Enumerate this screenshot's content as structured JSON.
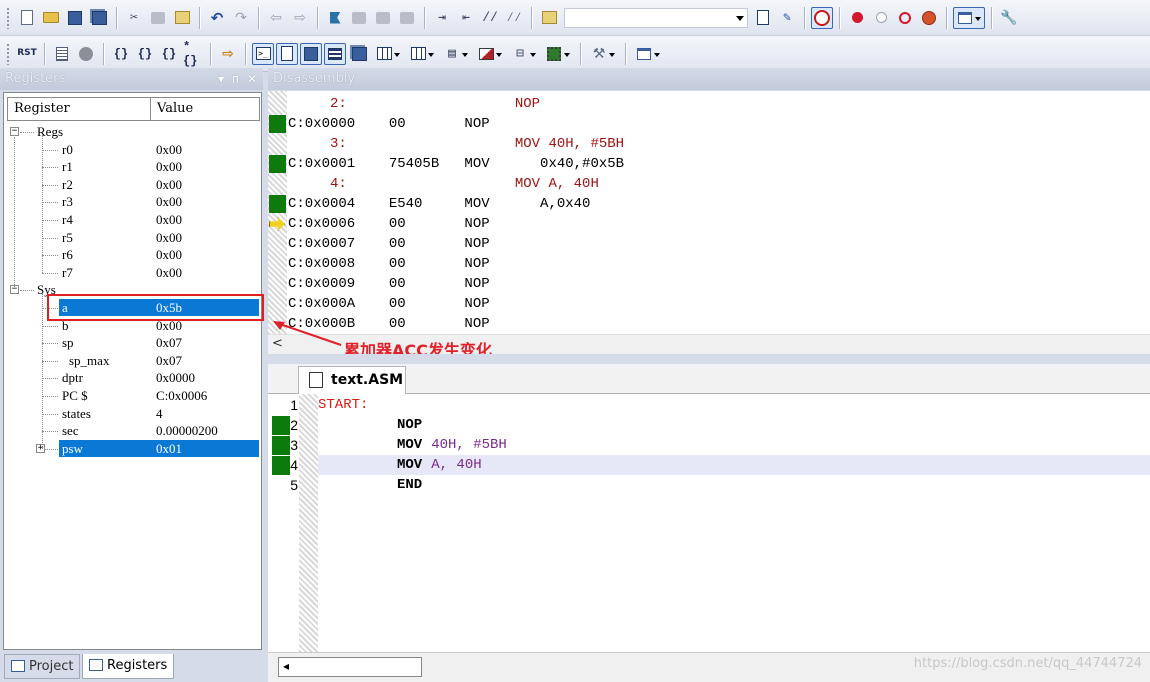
{
  "toolbar1": {
    "icons": [
      "new-file-icon",
      "open-folder-icon",
      "save-icon",
      "save-all-icon",
      "cut-icon",
      "copy-icon",
      "paste-icon",
      "undo-icon",
      "redo-icon",
      "nav-back-icon",
      "nav-forward-icon",
      "bookmark-icon",
      "bookmark-prev-icon",
      "bookmark-next-icon",
      "bookmark-clear-icon",
      "indent-icon",
      "unindent-icon",
      "comment-icon",
      "uncomment-icon",
      "find-in-files-icon",
      "target-combo",
      "find-icon",
      "insert-icon",
      "debug-session-icon",
      "breakpoint-insert-icon",
      "breakpoint-enable-icon",
      "breakpoint-disable-icon",
      "breakpoint-kill-icon",
      "window-layout-icon",
      "configure-icon"
    ],
    "target_combo_value": ""
  },
  "toolbar2": {
    "rst_label": "RST",
    "icons": [
      "reset-icon",
      "run-icon",
      "stop-icon",
      "step-into-icon",
      "step-over-icon",
      "step-out-icon",
      "run-to-cursor-icon",
      "show-next-statement-icon",
      "command-window-icon",
      "disassembly-window-icon",
      "symbols-window-icon",
      "registers-window-icon",
      "call-stack-icon",
      "watch-window-icon",
      "memory-window-icon",
      "serial-window-icon",
      "analysis-window-icon",
      "trace-window-icon",
      "system-viewer-icon",
      "toolbox-icon",
      "debug-restore-icon"
    ]
  },
  "registers": {
    "title": "Registers",
    "caption_buttons": [
      "▾",
      "ᴨ",
      "✕"
    ],
    "col_register": "Register",
    "col_value": "Value",
    "groups": [
      {
        "name": "Regs",
        "expander": "−",
        "rows": [
          {
            "name": "r0",
            "value": "0x00"
          },
          {
            "name": "r1",
            "value": "0x00"
          },
          {
            "name": "r2",
            "value": "0x00"
          },
          {
            "name": "r3",
            "value": "0x00"
          },
          {
            "name": "r4",
            "value": "0x00"
          },
          {
            "name": "r5",
            "value": "0x00"
          },
          {
            "name": "r6",
            "value": "0x00"
          },
          {
            "name": "r7",
            "value": "0x00"
          }
        ]
      },
      {
        "name": "Sys",
        "expander": "−",
        "rows": [
          {
            "name": "a",
            "value": "0x5b"
          },
          {
            "name": "b",
            "value": "0x00"
          },
          {
            "name": "sp",
            "value": "0x07"
          },
          {
            "name": "sp_max",
            "value": "0x07"
          },
          {
            "name": "dptr",
            "value": "0x0000"
          },
          {
            "name": "PC  $",
            "value": "C:0x0006"
          },
          {
            "name": "states",
            "value": "4"
          },
          {
            "name": "sec",
            "value": "0.00000200"
          },
          {
            "name": "psw",
            "value": "0x01",
            "expander": "+"
          }
        ]
      }
    ],
    "tabs": [
      {
        "label": "Project"
      },
      {
        "label": "Registers"
      }
    ]
  },
  "disassembly": {
    "title": "Disassembly",
    "rows": [
      {
        "kind": "src",
        "text": "     2:                    NOP"
      },
      {
        "kind": "asm",
        "text": "C:0x0000    00       NOP"
      },
      {
        "kind": "src",
        "text": "     3:                    MOV 40H, #5BH"
      },
      {
        "kind": "asm",
        "text": "C:0x0001    75405B   MOV      0x40,#0x5B"
      },
      {
        "kind": "src",
        "text": "     4:                    MOV A, 40H"
      },
      {
        "kind": "asm",
        "text": "C:0x0004    E540     MOV      A,0x40"
      },
      {
        "kind": "asm",
        "text": "C:0x0006    00       NOP"
      },
      {
        "kind": "asm",
        "text": "C:0x0007    00       NOP"
      },
      {
        "kind": "asm",
        "text": "C:0x0008    00       NOP"
      },
      {
        "kind": "asm",
        "text": "C:0x0009    00       NOP"
      },
      {
        "kind": "asm",
        "text": "C:0x000A    00       NOP"
      },
      {
        "kind": "asm",
        "text": "C:0x000B    00       NOP"
      }
    ],
    "scroll_left": "<"
  },
  "annotation": "累加器ACC发生变化",
  "editor": {
    "tab_label": "text.ASM",
    "lines": [
      {
        "n": "1",
        "label": "START:",
        "op": "",
        "args": ""
      },
      {
        "n": "2",
        "label": "",
        "op": "NOP",
        "args": ""
      },
      {
        "n": "3",
        "label": "",
        "op": "MOV",
        "args": "40H, #5BH"
      },
      {
        "n": "4",
        "label": "",
        "op": "MOV",
        "args": "A, 40H"
      },
      {
        "n": "5",
        "label": "",
        "op": "END",
        "args": ""
      }
    ],
    "scroll_left": "◂"
  },
  "watermark": "https://blog.csdn.net/qq_44744724",
  "colors": {
    "selection": "#0a79d6",
    "annotation": "#e0202a",
    "exec_mark": "#0d7a0d",
    "current_line": "#e6e8f8"
  }
}
